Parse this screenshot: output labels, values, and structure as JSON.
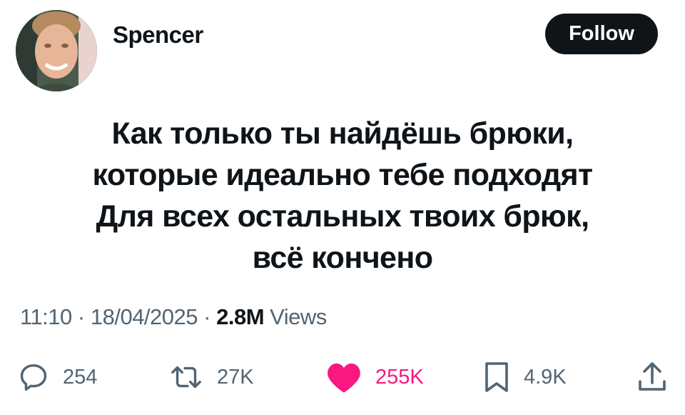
{
  "author": {
    "name": "Spencer",
    "follow_label": "Follow"
  },
  "tweet": {
    "lines": [
      "Как только ты найдёшь брюки,",
      "которые идеально тебе подходят",
      "Для всех остальных твоих брюк,",
      "всё кончено"
    ]
  },
  "meta": {
    "time": "11:10",
    "date": "18/04/2025",
    "separator": "·",
    "views_count": "2.8M",
    "views_label": "Views"
  },
  "actions": {
    "replies": "254",
    "reposts": "27K",
    "likes": "255K",
    "bookmarks": "4.9K"
  },
  "colors": {
    "text": "#0f1419",
    "secondary": "#536471",
    "like": "#f91880",
    "button_bg": "#0f1419"
  },
  "icons": [
    "reply-icon",
    "repost-icon",
    "heart-icon",
    "bookmark-icon",
    "share-icon"
  ]
}
